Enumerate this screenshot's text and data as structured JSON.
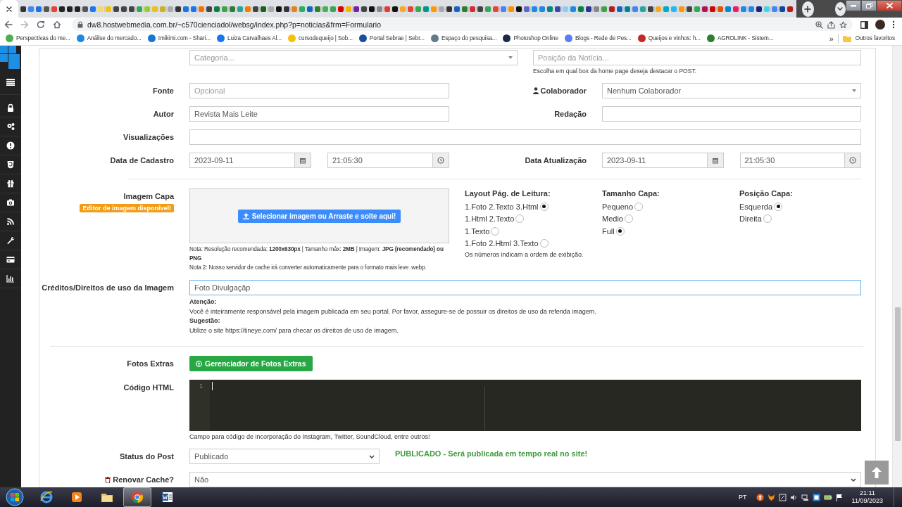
{
  "browser": {
    "tabs": [
      {
        "color": "#333333"
      },
      {
        "color": "#4285f4"
      },
      {
        "color": "#1a73e8"
      },
      {
        "color": "#555555"
      },
      {
        "color": "#ea4335"
      },
      {
        "color": "#222222"
      },
      {
        "color": "#222222"
      },
      {
        "color": "#222222"
      },
      {
        "color": "#555555"
      },
      {
        "color": "#1877f2"
      },
      {
        "color": "#f5d76e"
      },
      {
        "color": "#f4c20d"
      },
      {
        "color": "#444444"
      },
      {
        "color": "#444444"
      },
      {
        "color": "#444444"
      },
      {
        "color": "#34a853"
      },
      {
        "color": "#9acd32"
      },
      {
        "color": "#e8c21a"
      },
      {
        "color": "#c8b02a"
      },
      {
        "color": "#aaaaaa"
      },
      {
        "color": "#333333"
      },
      {
        "color": "#1a73e8"
      },
      {
        "color": "#1a73e8"
      },
      {
        "color": "#ff6d00"
      },
      {
        "color": "#444444"
      },
      {
        "color": "#0b8043"
      },
      {
        "color": "#43a047"
      },
      {
        "color": "#2e7d32"
      },
      {
        "color": "#26a69a"
      },
      {
        "color": "#f57c00"
      },
      {
        "color": "#444444"
      },
      {
        "color": "#1b5e20"
      },
      {
        "color": "#aaaaaa"
      },
      {
        "color": "#111111"
      },
      {
        "color": "#333333"
      },
      {
        "color": "#e67e22"
      },
      {
        "color": "#27ae60"
      },
      {
        "color": "#1565c0"
      },
      {
        "color": "#2e7d32"
      },
      {
        "color": "#4caf50"
      },
      {
        "color": "#34a853"
      },
      {
        "color": "#d50000"
      },
      {
        "color": "#f4b400"
      },
      {
        "color": "#7b1fa2"
      },
      {
        "color": "#444444"
      },
      {
        "color": "#111111"
      },
      {
        "color": "#888888"
      },
      {
        "color": "#e53935"
      },
      {
        "color": "#111111"
      },
      {
        "color": "#f9a825"
      },
      {
        "color": "#ea4335"
      },
      {
        "color": "#34a853"
      },
      {
        "color": "#009688"
      },
      {
        "color": "#ff9800"
      },
      {
        "color": "#aaaaaa"
      },
      {
        "color": "#333333"
      },
      {
        "color": "#1565c0"
      },
      {
        "color": "#2e7d32"
      },
      {
        "color": "#d32f2f"
      },
      {
        "color": "#444444"
      },
      {
        "color": "#34a853"
      },
      {
        "color": "#ea4335"
      },
      {
        "color": "#4285f4"
      },
      {
        "color": "#ff8f00"
      },
      {
        "color": "#111111"
      },
      {
        "color": "#5c6bc0"
      },
      {
        "color": "#1e88e5"
      },
      {
        "color": "#1e88e5"
      },
      {
        "color": "#00897b"
      },
      {
        "color": "#3949ab"
      },
      {
        "color": "#90caf9"
      },
      {
        "color": "#1e88e5"
      },
      {
        "color": "#0b8043"
      },
      {
        "color": "#283593"
      },
      {
        "color": "#888888"
      },
      {
        "color": "#43a047"
      },
      {
        "color": "#b71c1c"
      },
      {
        "color": "#1565c0"
      },
      {
        "color": "#00838f"
      },
      {
        "color": "#4285f4"
      },
      {
        "color": "#26a69a"
      },
      {
        "color": "#444444"
      },
      {
        "color": "#f9a825"
      },
      {
        "color": "#00acc1"
      },
      {
        "color": "#29b6f6"
      },
      {
        "color": "#ff9800"
      },
      {
        "color": "#444444"
      },
      {
        "color": "#34a853"
      },
      {
        "color": "#ad1457"
      },
      {
        "color": "#d50000"
      },
      {
        "color": "#e65100"
      },
      {
        "color": "#0288d1"
      },
      {
        "color": "#e91e63"
      },
      {
        "color": "#1e88e5"
      },
      {
        "color": "#1e88e5"
      },
      {
        "color": "#1a237e"
      },
      {
        "color": "#4dd0e1"
      },
      {
        "color": "#4285f4"
      },
      {
        "color": "#0d47a1"
      },
      {
        "color": "#b71c1c"
      }
    ],
    "url": "dw8.hostwebmedia.com.br/~c570cienciadol/websg/index.php?p=noticias&frm=Formulario",
    "bookmarks": [
      {
        "label": "Perspectivas do me...",
        "color": "#4caf50"
      },
      {
        "label": "Análise do mercado...",
        "color": "#1e88e5"
      },
      {
        "label": "Imikimi.com - Shari...",
        "color": "#1976d2"
      },
      {
        "label": "Luiza Carvalhaes Al...",
        "color": "#1877f2"
      },
      {
        "label": "cursodequeijo | Sob...",
        "color": "#f4c20d"
      },
      {
        "label": "Portal Sebrae | Sebr...",
        "color": "#1a4fa0"
      },
      {
        "label": "Espaço do pesquisa...",
        "color": "#607d8b"
      },
      {
        "label": "Photoshop Online",
        "color": "#1b2a4a"
      },
      {
        "label": "Blogs - Rede de Pes...",
        "color": "#5c7cfa"
      },
      {
        "label": "Queijos e vinhos: h...",
        "color": "#c62828"
      },
      {
        "label": "AGROLINK - Sistem...",
        "color": "#2e7d32"
      }
    ],
    "more_bookmarks": "»",
    "other_bookmarks": "Outros favoritos"
  },
  "form": {
    "categoria": {
      "placeholder": "Categoria..."
    },
    "posicao": {
      "placeholder": "Posição da Notícia...",
      "hint": "Escolha em qual box da home page deseja destacar o POST."
    },
    "fonte": {
      "label": "Fonte",
      "placeholder": "Opcional"
    },
    "colaborador": {
      "label": "Colaborador",
      "value": "Nenhum Colaborador"
    },
    "autor": {
      "label": "Autor",
      "value": "Revista Mais Leite"
    },
    "redacao": {
      "label": "Redação"
    },
    "visualizacoes": {
      "label": "Visualizações"
    },
    "data_cadastro": {
      "label": "Data de Cadastro",
      "date": "2023-09-11",
      "time": "21:05:30"
    },
    "data_atualizacao": {
      "label": "Data Atualização",
      "date": "2023-09-11",
      "time": "21:05:30"
    },
    "imagem_capa": {
      "label": "Imagem Capa",
      "badge": "Editor de imagem disponível!",
      "upload_button": "Selecionar imagem ou Arraste e solte aqui!",
      "note": "Nota: Resolução recomendada: **1200x630px** | Tamanho máx: **2MB** | Imagem: **JPG (recomendado) ou PNG**",
      "note2": "Nota 2: Nosso servidor de cache irá converter automaticamente para o formato mais leve .webp."
    },
    "options": [
      {
        "title": "Layout Pág. de Leitura:",
        "choices": [
          {
            "label": "1.Foto 2.Texto 3.Html",
            "selected": true
          },
          {
            "label": "1.Html 2.Texto",
            "selected": false
          },
          {
            "label": "1.Texto",
            "selected": false
          },
          {
            "label": "1.Foto 2.Html 3.Texto",
            "selected": false
          }
        ],
        "hint": "Os números indicam a ordem de exibição."
      },
      {
        "title": "Tamanho Capa:",
        "choices": [
          {
            "label": "Pequeno",
            "selected": false
          },
          {
            "label": "Medio",
            "selected": false
          },
          {
            "label": "Full",
            "selected": true
          }
        ]
      },
      {
        "title": "Posição Capa:",
        "choices": [
          {
            "label": "Esquerda",
            "selected": true
          },
          {
            "label": "Direita",
            "selected": false
          }
        ]
      }
    ],
    "creditos": {
      "label": "Créditos/Direitos de uso da Imagem",
      "value": "Foto Divulgaçãp",
      "notes": [
        {
          "kind": "heading",
          "text": "Atenção:"
        },
        {
          "kind": "text",
          "text": "Você é inteiramente responsável pela imagem publicada em seu portal. Por favor, assegure-se de possuir os direitos de uso da referida imagem."
        },
        {
          "kind": "heading",
          "text": "Sugestão:"
        },
        {
          "kind": "text",
          "text": "Utilize o site https://tineye.com/ para checar os direitos de uso de imagem."
        }
      ]
    },
    "fotos_extras": {
      "label": "Fotos Extras",
      "button": "Gerenciador de Fotos Extras"
    },
    "codigo_html": {
      "label": "Código HTML",
      "line_number": "1",
      "caption": "Campo para código de incorporação do Instagram, Twitter, SoundCloud, entre outros!"
    },
    "status": {
      "label": "Status do Post",
      "value": "Publicado",
      "message": "PUBLICADO - Será publicada em tempo real no site!"
    },
    "renovar_cache": {
      "label": "Renovar Cache?",
      "value": "Não"
    }
  },
  "taskbar": {
    "apps": [
      {
        "kind": "ie",
        "selected": false
      },
      {
        "kind": "media",
        "selected": false
      },
      {
        "kind": "folder",
        "selected": false
      },
      {
        "kind": "chrome",
        "selected": true
      },
      {
        "kind": "word",
        "selected": false
      }
    ],
    "language": "PT",
    "time": "21:11",
    "date": "11/09/2023"
  }
}
